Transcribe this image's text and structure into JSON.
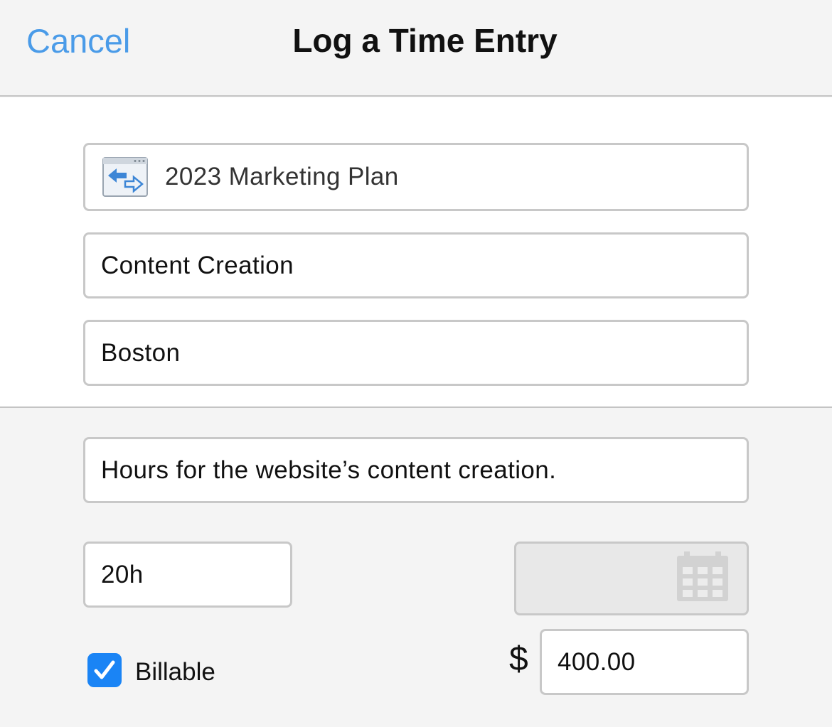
{
  "header": {
    "cancel_label": "Cancel",
    "title": "Log a Time Entry"
  },
  "form": {
    "project": {
      "value": "2023 Marketing Plan",
      "icon": "project-icon"
    },
    "task": {
      "value": "Content Creation"
    },
    "location": {
      "value": "Boston"
    },
    "notes": {
      "value": "Hours for the website’s content creation."
    },
    "hours": {
      "value": "20h"
    },
    "date": {
      "value": "",
      "icon": "calendar-icon"
    },
    "currency_symbol": "$",
    "amount": {
      "value": "400.00"
    },
    "billable": {
      "label": "Billable",
      "checked": true
    }
  },
  "colors": {
    "accent": "#4a9be8",
    "checkbox": "#1a84f5",
    "border": "#c8c8c8",
    "background": "#f4f4f4"
  }
}
